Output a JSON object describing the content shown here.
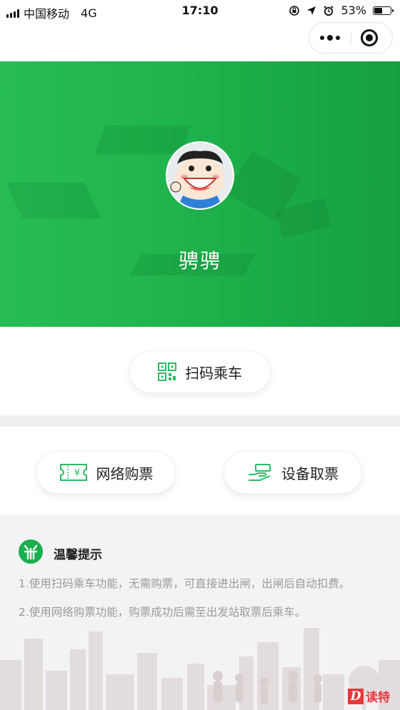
{
  "status_bar": {
    "carrier": "中国移动",
    "network": "4G",
    "time": "17:10",
    "battery": "53%",
    "battery_level": 0.53
  },
  "profile": {
    "nickname": "骋骋"
  },
  "actions": {
    "scan_ride": "扫码乘车",
    "online_ticket": "网络购票",
    "device_pickup": "设备取票"
  },
  "tips": {
    "title": "温馨提示",
    "items": [
      "1.使用扫码乘车功能，无需购票，可直接进出闸，出闸后自动扣费。",
      "2.使用网络购票功能，购票成功后需至出发站取票后乘车。"
    ]
  },
  "watermark": {
    "letter": "D",
    "text": "读特"
  },
  "colors": {
    "brand_green": "#1fb34c",
    "icon_green": "#2dbb64",
    "tips_text": "#9a9a9a",
    "watermark_red": "#e8383d"
  }
}
